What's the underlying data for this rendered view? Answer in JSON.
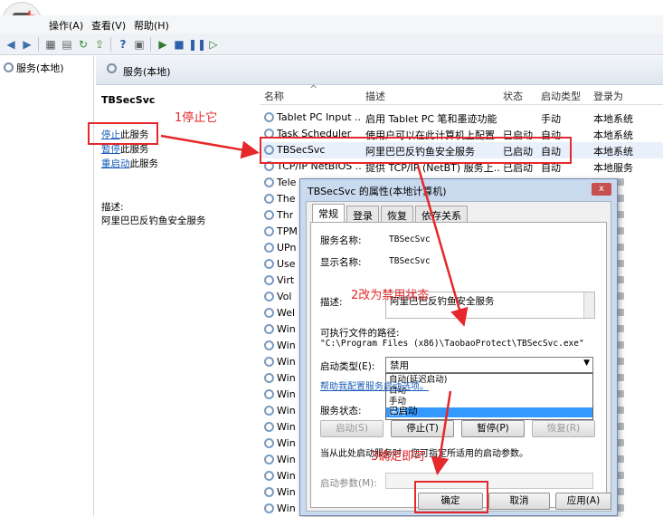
{
  "menu": [
    "操作(A)",
    "查看(V)",
    "帮助(H)"
  ],
  "tree": {
    "root": "服务(本地)"
  },
  "panel_header": "服务(本地)",
  "detail": {
    "service_name": "TBSecSvc",
    "actions": [
      {
        "link": "停止",
        "rest": "此服务"
      },
      {
        "link": "暂停",
        "rest": "此服务"
      },
      {
        "link": "重启动",
        "rest": "此服务"
      }
    ],
    "desc_label": "描述:",
    "desc_text": "阿里巴巴反钓鱼安全服务"
  },
  "list": {
    "columns": [
      "名称",
      "描述",
      "状态",
      "启动类型",
      "登录为"
    ],
    "rows": [
      {
        "name": "Tablet PC Input ...",
        "desc": "启用 Tablet PC 笔和墨迹功能",
        "status": "",
        "startup": "手动",
        "logon": "本地系统"
      },
      {
        "name": "Task Scheduler",
        "desc": "使用户可以在此计算机上配置...",
        "status": "已启动",
        "startup": "自动",
        "logon": "本地系统"
      },
      {
        "name": "TBSecSvc",
        "desc": "阿里巴巴反钓鱼安全服务",
        "status": "已启动",
        "startup": "自动",
        "logon": "本地系统"
      },
      {
        "name": "TCP/IP NetBIOS ...",
        "desc": "提供 TCP/IP (NetBT) 服务上...",
        "status": "已启动",
        "startup": "自动",
        "logon": "本地服务"
      }
    ],
    "partial_names": [
      "Tele",
      "The",
      "Thr",
      "TPM",
      "UPn",
      "Use",
      "Virt",
      "Vol",
      "Wel",
      "Win",
      "Win",
      "Win",
      "Win",
      "Win",
      "Win",
      "Win",
      "Win",
      "Win",
      "Win",
      "Win",
      "Win"
    ]
  },
  "dialog": {
    "title": "TBSecSvc 的属性(本地计算机)",
    "close": "x",
    "tabs": [
      "常规",
      "登录",
      "恢复",
      "依存关系"
    ],
    "service_name_label": "服务名称:",
    "service_name_value": "TBSecSvc",
    "display_name_label": "显示名称:",
    "display_name_value": "TBSecSvc",
    "desc_label": "描述:",
    "desc_value": "阿里巴巴反钓鱼安全服务",
    "path_label": "可执行文件的路径:",
    "path_value": "\"C:\\Program Files (x86)\\TaobaoProtect\\TBSecSvc.exe\"",
    "startup_label": "启动类型(E):",
    "startup_value": "禁用",
    "startup_options": [
      "自动(延迟启动)",
      "自动",
      "手动",
      "禁用"
    ],
    "help_link": "帮助我配置服务启动选项。",
    "status_label": "服务状态:",
    "status_value": "已启动",
    "buttons": [
      "启动(S)",
      "停止(T)",
      "暂停(P)",
      "恢复(R)"
    ],
    "hint": "当从此处启动服务时，您可指定所适用的启动参数。",
    "params_label": "启动参数(M):",
    "ok": "确定",
    "cancel": "取消",
    "apply": "应用(A)"
  },
  "annotations": {
    "step1": "1停止它",
    "step2": "2改为禁用状态",
    "step3": "3确定即可"
  },
  "colors": {
    "annotation": "#e5282b",
    "link": "#1a5bb8",
    "selection": "#3399ff"
  }
}
